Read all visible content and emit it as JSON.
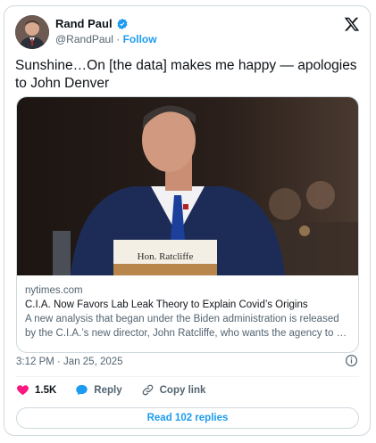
{
  "author": {
    "name": "Rand Paul",
    "handle": "@RandPaul",
    "separator": "·",
    "follow_label": "Follow",
    "verified": true
  },
  "tweet": {
    "text": "Sunshine…On [the data] makes me happy — apologies to John Denver"
  },
  "link_card": {
    "domain": "nytimes.com",
    "headline": "C.I.A. Now Favors Lab Leak Theory to Explain Covid’s Origins",
    "description_line1": "A new analysis that began under the Biden administration is released",
    "description_line2": "by the C.I.A.’s new director, John Ratcliffe, who wants the agency to g…",
    "photo_placard": "Hon. Ratcliffe"
  },
  "timestamp": "3:12 PM · Jan 25, 2025",
  "actions": {
    "like_count": "1.5K",
    "reply_label": "Reply",
    "copy_label": "Copy link"
  },
  "read_replies": "Read 102 replies",
  "colors": {
    "accent": "#1d9bf0",
    "like": "#f91880",
    "text": "#0f1419",
    "muted": "#536471",
    "border": "#cfd9de"
  },
  "icons": [
    "verified-badge-icon",
    "x-logo-icon",
    "info-icon",
    "heart-icon",
    "reply-icon",
    "link-icon"
  ]
}
